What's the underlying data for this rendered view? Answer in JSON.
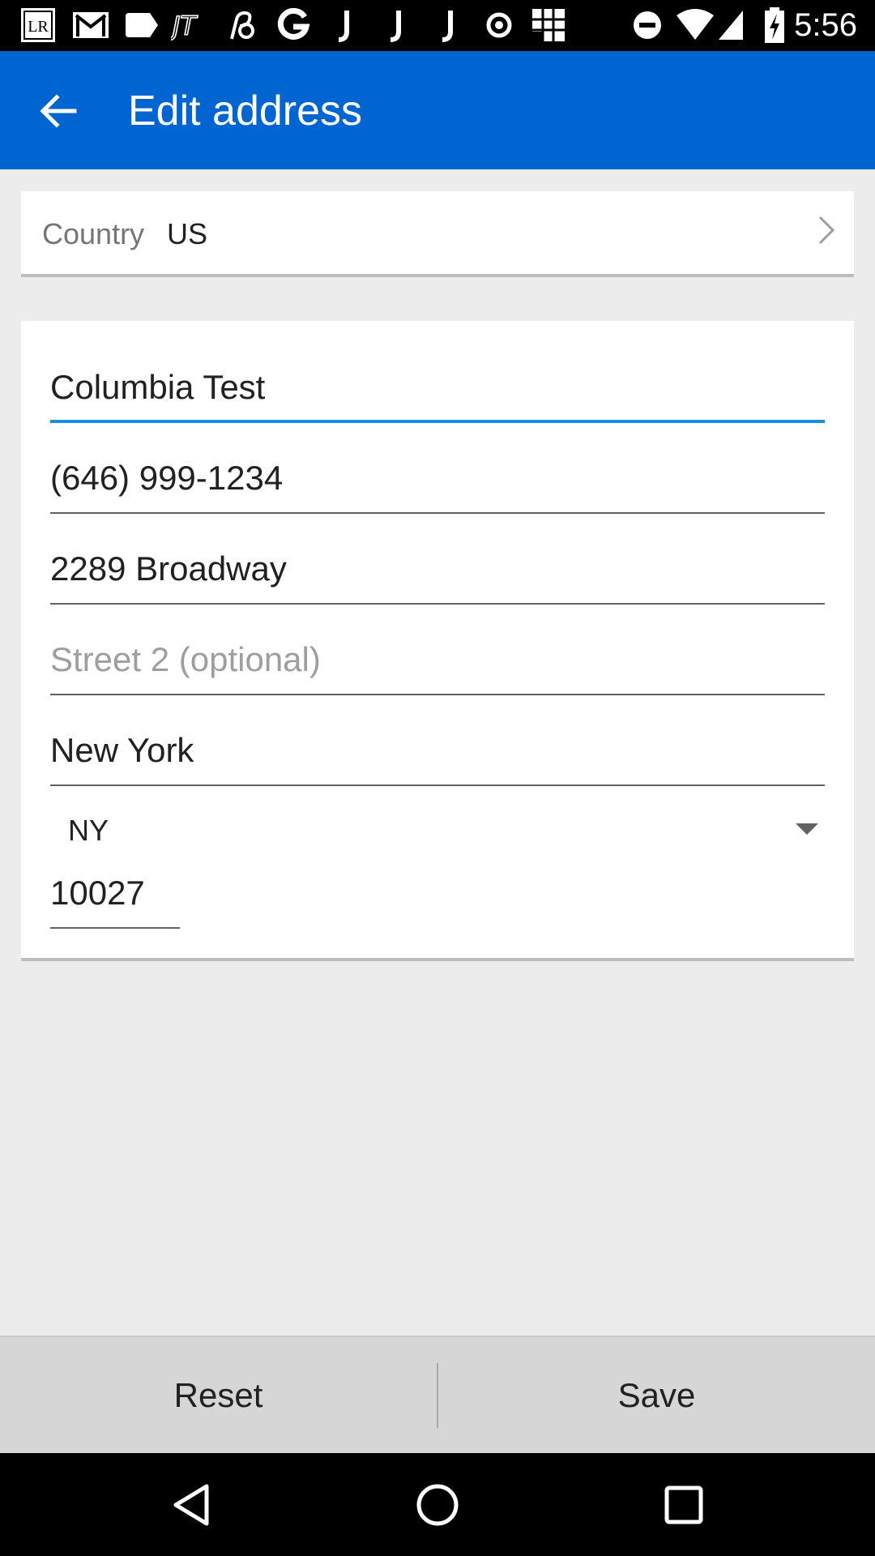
{
  "status_bar": {
    "time": "5:56",
    "notification_icons": [
      "lr-app-icon",
      "gmail-icon",
      "tag-icon",
      "jt-app-icon",
      "link-app-icon",
      "google-icon",
      "j-app-icon",
      "j-app-icon",
      "j-app-icon",
      "circle-dot-icon",
      "grid-app-icon"
    ],
    "system_icons": [
      "do-not-disturb-icon",
      "wifi-icon",
      "cell-signal-icon",
      "battery-charging-icon"
    ]
  },
  "app_bar": {
    "title": "Edit address",
    "background_color": "#0065d1"
  },
  "country": {
    "label": "Country",
    "value": "US"
  },
  "form": {
    "name": "Columbia Test",
    "phone": "(646) 999-1234",
    "street1": "2289 Broadway",
    "street2_placeholder": "Street 2 (optional)",
    "city": "New York",
    "state": "NY",
    "zip": "10027",
    "focus_color": "#1a8fe0"
  },
  "actions": {
    "reset_label": "Reset",
    "save_label": "Save"
  },
  "nav_bar": {
    "buttons": [
      "back-nav-icon",
      "home-nav-icon",
      "recents-nav-icon"
    ]
  }
}
